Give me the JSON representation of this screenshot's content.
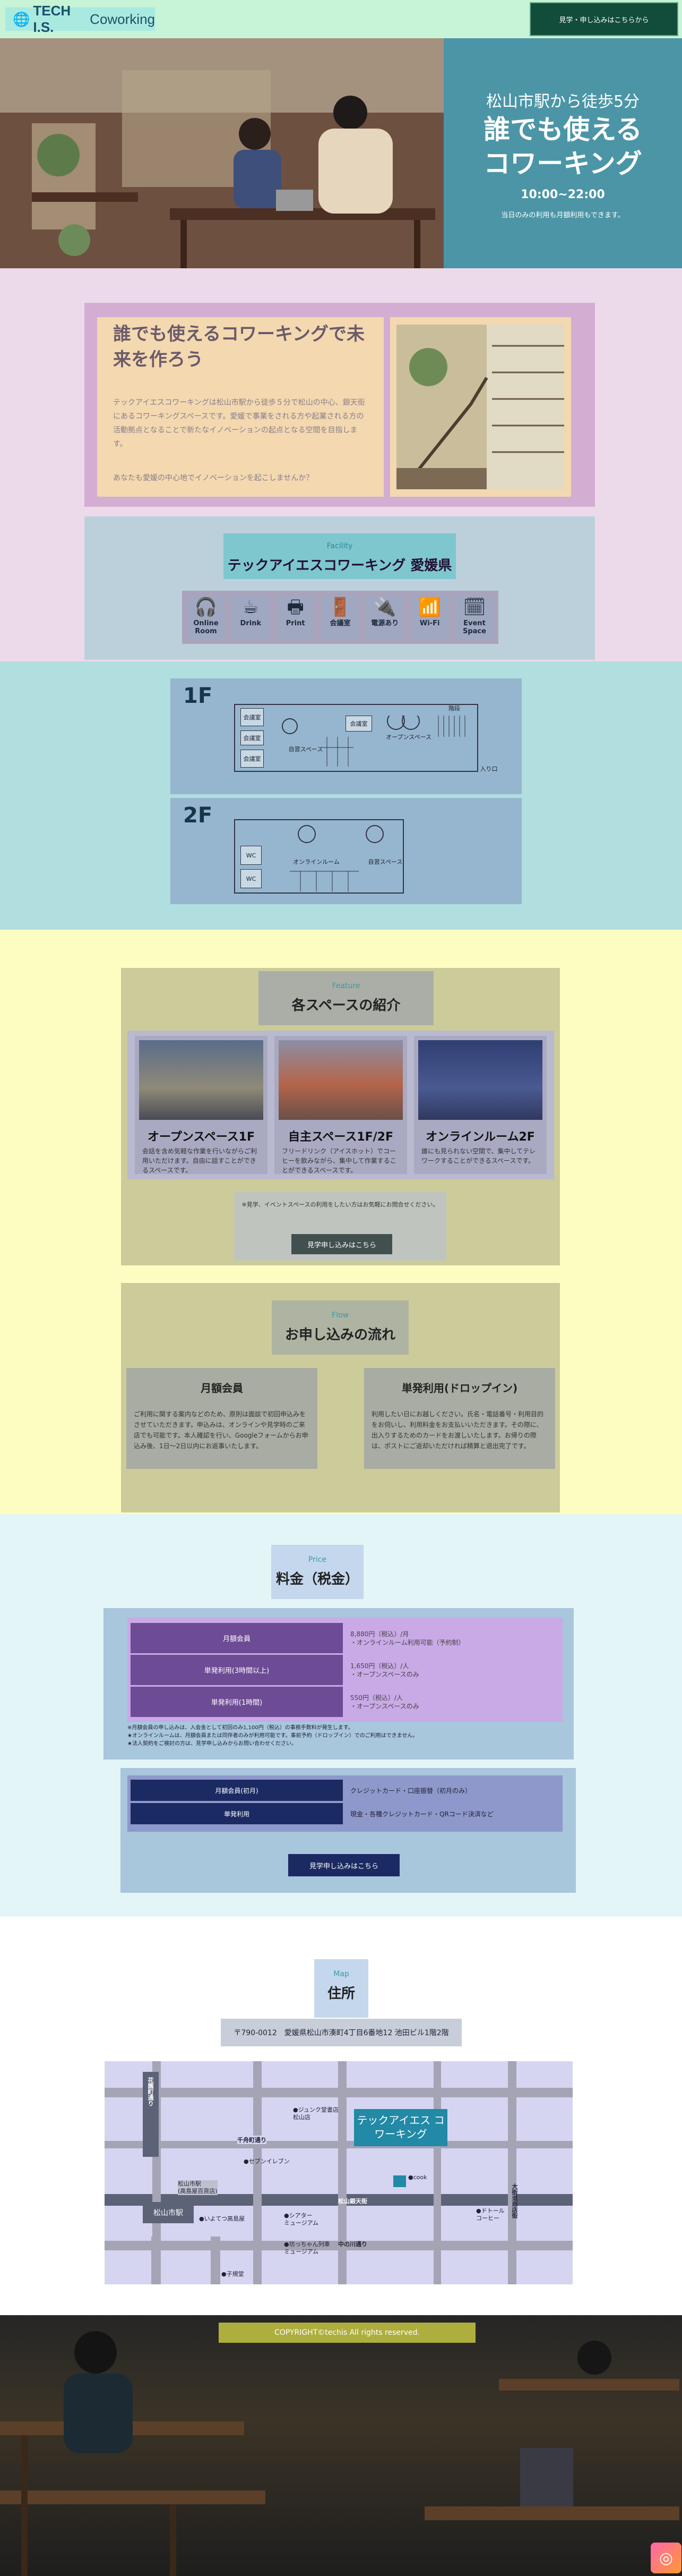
{
  "header": {
    "logo_glyph": "🌐",
    "logo_brand": "TECH I.S.",
    "logo_sub": "Coworking",
    "cta": "見学・申し込みはこちらから"
  },
  "hero": {
    "line1": "松山市駅から徒歩5分",
    "line2": "誰でも使える",
    "line3": "コワーキング",
    "hours": "10:00~22:00",
    "note": "当日のみの利用も月額利用もできます。"
  },
  "intro": {
    "title": "誰でも使えるコワーキングで未来を作ろう",
    "body": "テックアイエスコワーキングは松山市駅から徒歩５分で松山の中心、銀天街にあるコワーキングスペースです。愛媛で事業をされる方や起業される方の活動拠点となることで新たなイノベーションの起点となる空間を目指します。",
    "question": "あなたも愛媛の中心地でイノベーションを起こしませんか？"
  },
  "facility": {
    "sub": "Facility",
    "title": "テックアイエスコワーキング 愛媛県",
    "items": [
      {
        "icon": "headphones-icon",
        "glyph": "🎧",
        "label": "Online Room"
      },
      {
        "icon": "cup-icon",
        "glyph": "☕",
        "label": "Drink"
      },
      {
        "icon": "printer-icon",
        "glyph": "🖶",
        "label": "Print"
      },
      {
        "icon": "door-icon",
        "glyph": "🚪",
        "label": "会議室"
      },
      {
        "icon": "plug-icon",
        "glyph": "🔌",
        "label": "電源あり"
      },
      {
        "icon": "wifi-icon",
        "glyph": "📶",
        "label": "Wi-Fi"
      },
      {
        "icon": "event-icon",
        "glyph": "🗓",
        "label": "Event Space"
      }
    ]
  },
  "floors": {
    "f1": {
      "label": "1F",
      "rooms": [
        "会議室",
        "会議室",
        "会議室",
        "自習スペース",
        "オープンスペース",
        "階段",
        "入り口"
      ]
    },
    "f2": {
      "label": "2F",
      "rooms": [
        "WC",
        "WC",
        "オンラインルーム",
        "自習スペース"
      ]
    }
  },
  "feature": {
    "sub": "Feature",
    "title": "各スペースの紹介",
    "cards": [
      {
        "title": "オープンスペース1F",
        "desc": "会話を含め気軽な作業を行いながらご利用いただけます。自由に話すことができるスペースです。"
      },
      {
        "title": "自主スペース1F/2F",
        "desc": "フリードリンク（アイスホット）でコーヒーを飲みながら、集中して作業することができるスペースです。"
      },
      {
        "title": "オンラインルーム2F",
        "desc": "誰にも見られない空間で、集中してテレワークすることができるスペースです。"
      }
    ],
    "notice": "※見学、イベントスペースの利用をしたい方はお気軽にお問合せください。",
    "button": "見学申し込みはこちら"
  },
  "flow": {
    "sub": "Flow",
    "title": "お申し込みの流れ",
    "cards": [
      {
        "title": "月額会員",
        "desc": "ご利用に関する案内などのため、原則は面談で初回申込みをさせていただきます。申込みは、オンラインや見学時のご来店でも可能です。本人確認を行い、Googleフォームからお申込み後、1日～2日以内にお返事いたします。"
      },
      {
        "title": "単発利用(ドロップイン)",
        "desc": "利用したい日にお越しください。氏名・電話番号・利用目的をお伺いし、利用料金をお支払いいただきます。その際に、出入りするためのカードをお渡しいたします。お帰りの際は、ポストにご返却いただければ精算と退出完了です。"
      }
    ]
  },
  "price": {
    "sub": "Price",
    "title": "料金（税金）",
    "rows": [
      {
        "k": "月額会員",
        "v1": "8,880円（税込）/月",
        "v2": "・オンラインルーム利用可能（予約制）"
      },
      {
        "k": "単発利用(3時間以上)",
        "v1": "1,650円（税込）/人",
        "v2": "・オープンスペースのみ"
      },
      {
        "k": "単発利用(1時間)",
        "v1": "550円（税込）/人",
        "v2": "・オープンスペースのみ"
      }
    ],
    "note1": "※月額会員の申し込みは、入会金として初回のみ1,100円（税込）の事務手数料が発生します。",
    "note2": "★オンラインルームは、月額会員または同伴者のみが利用可能です。事前予約（ドロップイン）でのご利用はできません。",
    "note3": "★法人契約をご検討の方は、見学申し込みからお問い合わせください。",
    "pay_rows": [
      {
        "k": "月額会員(初月)",
        "v": "クレジットカード・口座振替（初月のみ）"
      },
      {
        "k": "単発利用",
        "v": "現金・各種クレジットカード・QRコード決済など"
      }
    ],
    "button": "見学申し込みはこちら"
  },
  "map": {
    "sub": "Map",
    "title": "住所",
    "address": "〒790-0012　愛媛県松山市湊町4丁目6番地12 池田ビル1階2階",
    "callout": "テックアイエス コワーキング",
    "labels": {
      "junku": "●ジュンク堂書店\n松山店",
      "seven": "●セブンイレブン",
      "kita": "千舟町通り",
      "ginten": "松山銀天街",
      "station": "松山市駅",
      "takashima": "松山市駅\n(高島屋百貨店)",
      "iyotetsu": "●いよてつ高島屋",
      "theater": "●シアター\nミュージアム",
      "minami": "●坊っちゃん列車\nミュージアム",
      "taxi": "●子規堂",
      "doutor": "●ドトール\nコーヒー",
      "cook": "●cook",
      "hanazono": "花園町通り",
      "okaido": "大街道商店街",
      "naka": "中の川通り"
    }
  },
  "footer": {
    "copyright": "COPYRIGHT©techis All rights reserved.",
    "insta_glyph": "◎"
  }
}
